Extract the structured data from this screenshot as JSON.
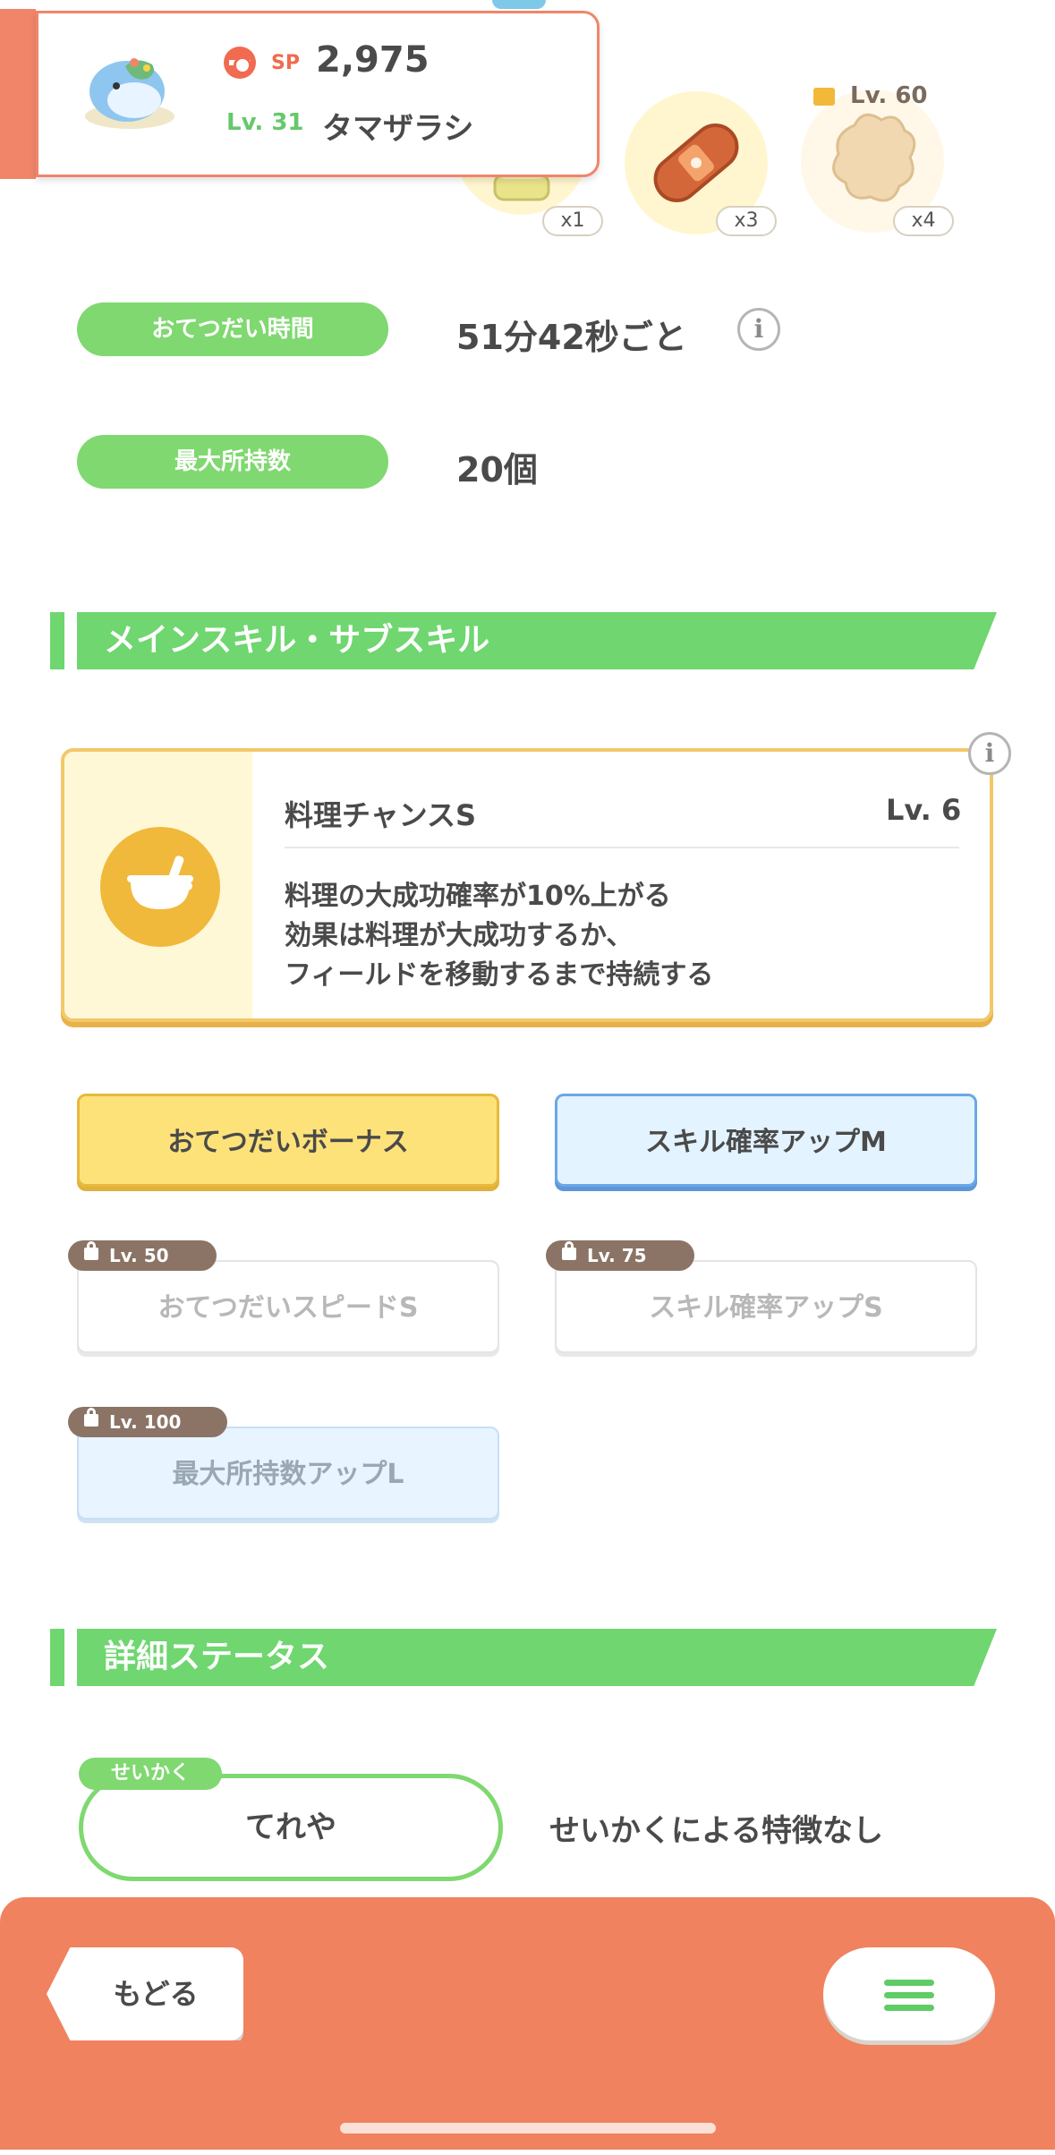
{
  "header": {
    "sp_label": "SP",
    "sp_value": "2,975",
    "level": "Lv. 31",
    "pokemon_name": "タマザラシ"
  },
  "ingredients": [
    {
      "icon": "ingredient-1-icon",
      "count": "x1"
    },
    {
      "icon": "sausage-icon",
      "count": "x3"
    },
    {
      "icon": "ginger-icon",
      "count": "x4",
      "lock_level": "Lv. 60"
    }
  ],
  "stats": {
    "help_time_label": "おてつだい時間",
    "help_time_value": "51分42秒ごと",
    "max_carry_label": "最大所持数",
    "max_carry_value": "20個"
  },
  "skills_section": {
    "title": "メインスキル・サブスキル",
    "main_skill": {
      "name": "料理チャンスS",
      "level": "Lv. 6",
      "desc_line1": "料理の大成功確率が10%上がる",
      "desc_line2": "効果は料理が大成功するか、",
      "desc_line3": "フィールドを移動するまで持続する"
    },
    "sub_skills": [
      {
        "label": "おてつだいボーナス"
      },
      {
        "label": "スキル確率アップM"
      },
      {
        "label": "おてつだいスピードS",
        "lock": "Lv. 50"
      },
      {
        "label": "スキル確率アップS",
        "lock": "Lv. 75"
      },
      {
        "label": "最大所持数アップL",
        "lock": "Lv. 100"
      }
    ]
  },
  "details_section": {
    "title": "詳細ステータス",
    "nature_tag": "せいかく",
    "nature_value": "てれや",
    "nature_desc": "せいかくによる特徴なし"
  },
  "bottom": {
    "back_label": "もどる"
  },
  "colors": {
    "accent_green": "#6fd670",
    "accent_orange": "#f0825f",
    "gold": "#fde27a",
    "blue": "#e3f3ff"
  }
}
